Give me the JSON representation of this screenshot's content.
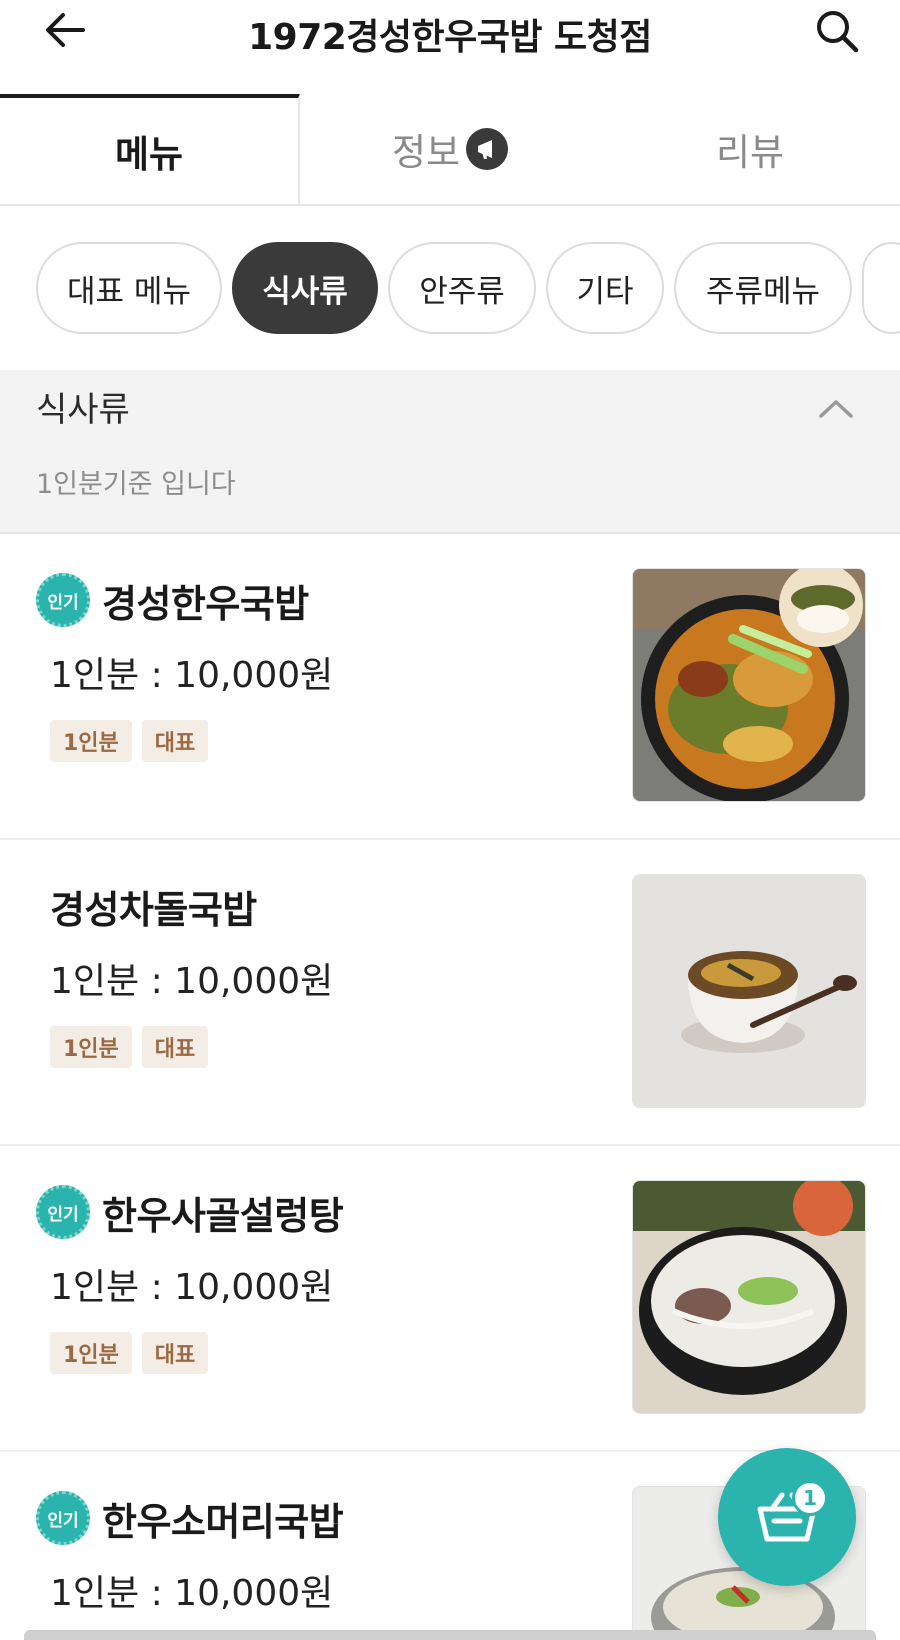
{
  "header": {
    "title": "1972경성한우국밥 도청점",
    "back_icon": "arrow-left-icon",
    "search_icon": "search-icon"
  },
  "tabs": [
    {
      "label": "메뉴",
      "active": true
    },
    {
      "label": "정보",
      "active": false,
      "icon": "megaphone-icon"
    },
    {
      "label": "리뷰",
      "active": false
    }
  ],
  "categories": [
    {
      "label": "대표 메뉴",
      "active": false
    },
    {
      "label": "식사류",
      "active": true
    },
    {
      "label": "안주류",
      "active": false
    },
    {
      "label": "기타",
      "active": false
    },
    {
      "label": "주류메뉴",
      "active": false
    }
  ],
  "section": {
    "title": "식사류",
    "subtitle": "1인분기준 입니다",
    "toggle_icon": "chevron-up-icon"
  },
  "popular_label": "인기",
  "items": [
    {
      "name": "경성한우국밥",
      "price": "1인분 : 10,000원",
      "popular": true,
      "tags": [
        "1인분",
        "대표"
      ],
      "photo": "spicy-beef-soup-photo"
    },
    {
      "name": "경성차돌국밥",
      "price": "1인분 : 10,000원",
      "popular": false,
      "tags": [
        "1인분",
        "대표"
      ],
      "photo": "brisket-soup-bowl-photo"
    },
    {
      "name": "한우사골설렁탕",
      "price": "1인분 : 10,000원",
      "popular": true,
      "tags": [
        "1인분",
        "대표"
      ],
      "photo": "bone-broth-soup-photo"
    },
    {
      "name": "한우소머리국밥",
      "price": "1인분 : 10,000원",
      "popular": true,
      "tags": [],
      "photo": "beef-head-soup-photo"
    }
  ],
  "cart": {
    "count": "1",
    "icon": "cart-icon"
  },
  "colors": {
    "accent": "#2ab4ad",
    "chip_active": "#3a3a3a",
    "tag_bg": "#f4ede6",
    "tag_text": "#9b6a44"
  }
}
